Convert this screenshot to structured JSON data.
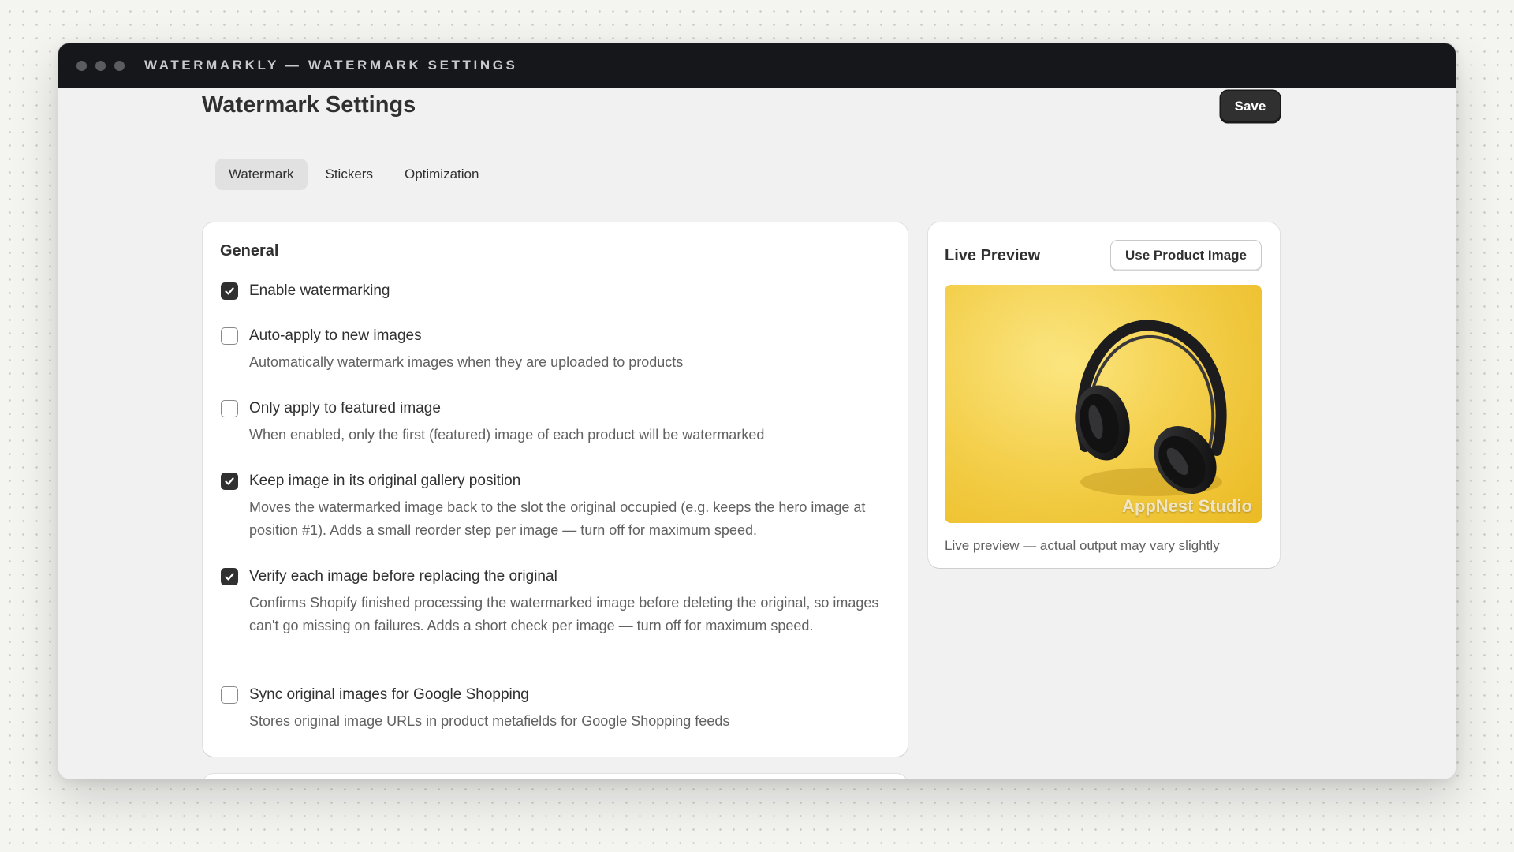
{
  "window": {
    "title": "WATERMARKLY — WATERMARK SETTINGS"
  },
  "header": {
    "title": "Watermark Settings",
    "save_label": "Save"
  },
  "tabs": [
    {
      "label": "Watermark",
      "active": true
    },
    {
      "label": "Stickers",
      "active": false
    },
    {
      "label": "Optimization",
      "active": false
    }
  ],
  "general": {
    "heading": "General",
    "options": [
      {
        "label": "Enable watermarking",
        "checked": true,
        "help": ""
      },
      {
        "label": "Auto-apply to new images",
        "checked": false,
        "help": "Automatically watermark images when they are uploaded to products"
      },
      {
        "label": "Only apply to featured image",
        "checked": false,
        "help": "When enabled, only the first (featured) image of each product will be watermarked"
      },
      {
        "label": "Keep image in its original gallery position",
        "checked": true,
        "help": "Moves the watermarked image back to the slot the original occupied (e.g. keeps the hero image at position #1). Adds a small reorder step per image — turn off for maximum speed."
      },
      {
        "label": "Verify each image before replacing the original",
        "checked": true,
        "help": "Confirms Shopify finished processing the watermarked image before deleting the original, so images can't go missing on failures. Adds a short check per image — turn off for maximum speed."
      },
      {
        "label": "Sync original images for Google Shopping",
        "checked": false,
        "help": "Stores original image URLs in product metafields for Google Shopping feeds"
      }
    ]
  },
  "preview": {
    "heading": "Live Preview",
    "button_label": "Use Product Image",
    "watermark_text": "AppNest Studio",
    "caption": "Live preview — actual output may vary slightly"
  },
  "colors": {
    "titlebar": "#16171a",
    "primary_button": "#303030",
    "checkbox_checked": "#303030",
    "preview_background": "#f7d34a"
  }
}
